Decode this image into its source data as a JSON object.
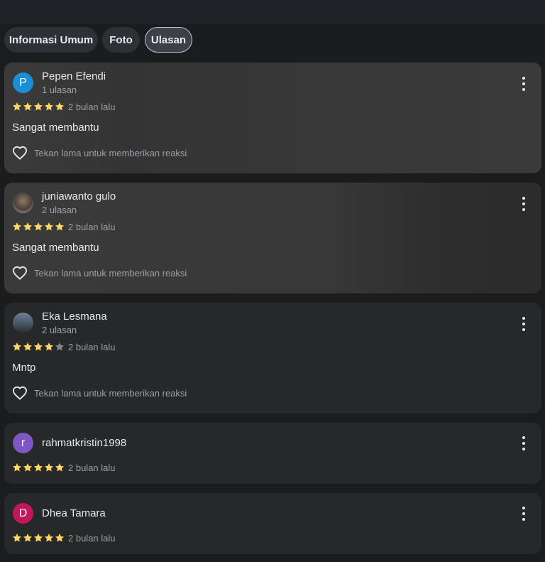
{
  "tabs": [
    {
      "label": "Informasi Umum"
    },
    {
      "label": "Foto"
    },
    {
      "label": "Ulasan",
      "active": true
    }
  ],
  "reaction_hint": "Tekan lama untuk memberikan reaksi",
  "colors": {
    "star_filled": "#fdd663",
    "star_empty": "#80868b",
    "avatar_p": "#1a8fd6",
    "avatar_r": "#7e57c2",
    "avatar_d": "#c2185b"
  },
  "reviews": [
    {
      "name": "Pepen Efendi",
      "count": "1 ulasan",
      "rating": 5,
      "date": "2 bulan lalu",
      "text": "Sangat membantu",
      "avatar_letter": "P"
    },
    {
      "name": "juniawanto gulo",
      "count": "2 ulasan",
      "rating": 5,
      "date": "2 bulan lalu",
      "text": "Sangat membantu",
      "avatar_letter": ""
    },
    {
      "name": "Eka Lesmana",
      "count": "2 ulasan",
      "rating": 4,
      "date": "2 bulan lalu",
      "text": "Mntp",
      "avatar_letter": ""
    },
    {
      "name": "rahmatkristin1998",
      "count": "",
      "rating": 5,
      "date": "2 bulan lalu",
      "text": "",
      "avatar_letter": "r"
    },
    {
      "name": "Dhea Tamara",
      "count": "",
      "rating": 5,
      "date": "2 bulan lalu",
      "text": "",
      "avatar_letter": "D"
    }
  ]
}
